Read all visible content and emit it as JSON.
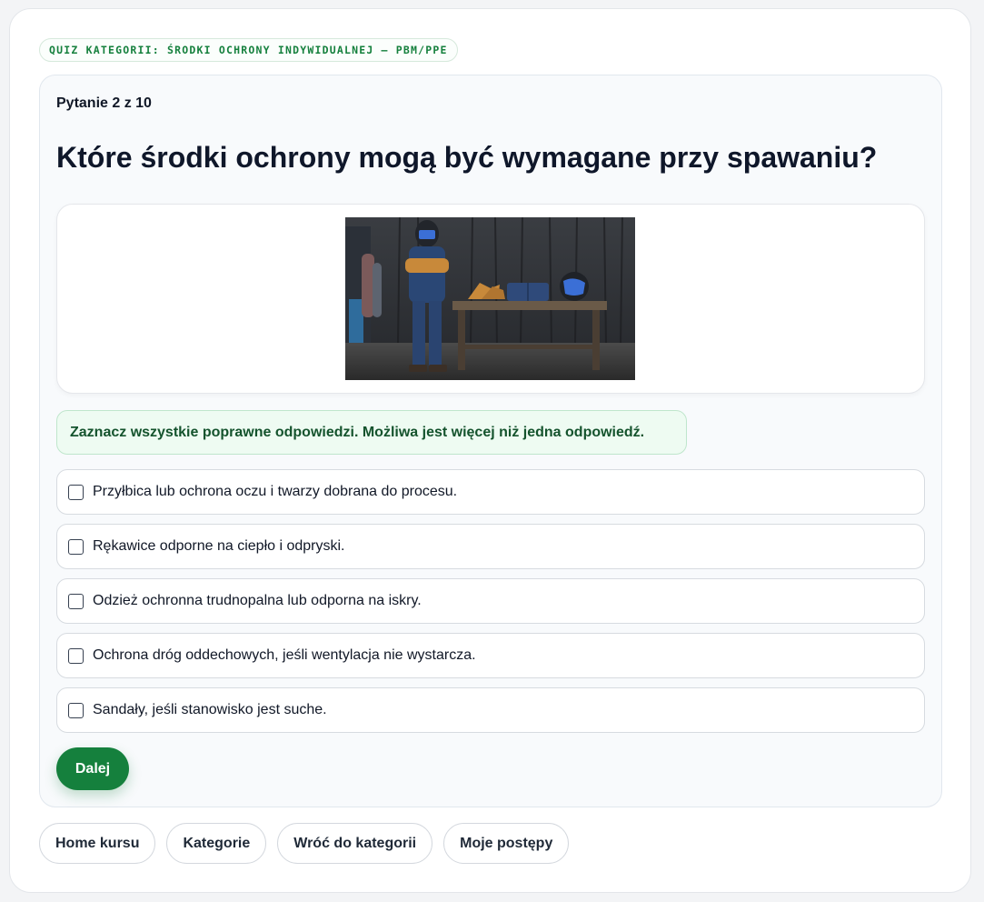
{
  "category_tag": "QUIZ KATEGORII: ŚRODKI OCHRONY INDYWIDUALNEJ — PBM/PPE",
  "quiz": {
    "progress": "Pytanie 2 z 10",
    "question": "Które środki ochrony mogą być wymagane przy spawaniu?",
    "image_alt": "Spawacz w masce i rękawicach obok stołu z odzieżą ochronną",
    "instruction": "Zaznacz wszystkie poprawne odpowiedzi. Możliwa jest więcej niż jedna odpowiedź.",
    "answers": [
      {
        "label": "Przyłbica lub ochrona oczu i twarzy dobrana do procesu.",
        "checked": false
      },
      {
        "label": "Rękawice odporne na ciepło i odpryski.",
        "checked": false
      },
      {
        "label": "Odzież ochronna trudnopalna lub odporna na iskry.",
        "checked": false
      },
      {
        "label": "Ochrona dróg oddechowych, jeśli wentylacja nie wystarcza.",
        "checked": false
      },
      {
        "label": "Sandały, jeśli stanowisko jest suche.",
        "checked": false
      }
    ],
    "next_label": "Dalej"
  },
  "nav": {
    "home": "Home kursu",
    "categories": "Kategorie",
    "back": "Wróć do kategorii",
    "progress": "Moje postępy"
  },
  "colors": {
    "accent": "#15803d",
    "instruction_bg": "#eefbf2",
    "instruction_text": "#14532d"
  }
}
